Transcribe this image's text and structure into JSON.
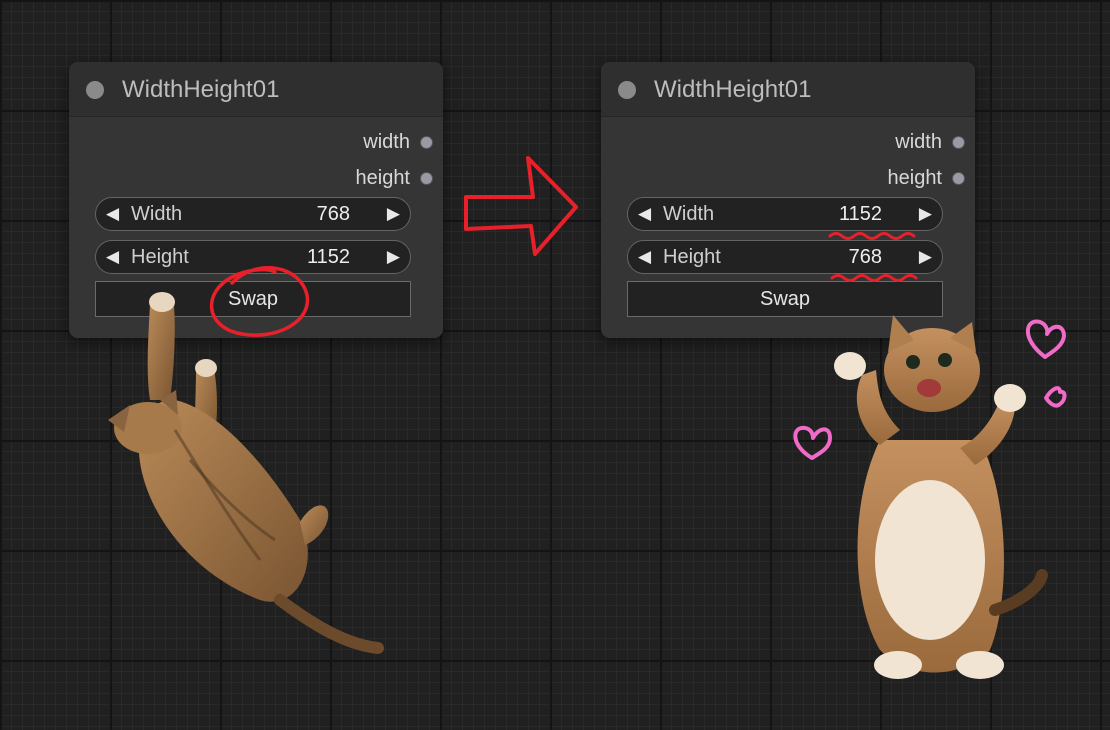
{
  "nodes": [
    {
      "title": "WidthHeight01",
      "outputs": [
        "width",
        "height"
      ],
      "widgets": [
        {
          "label": "Width",
          "value": "768"
        },
        {
          "label": "Height",
          "value": "1152"
        }
      ],
      "button_label": "Swap"
    },
    {
      "title": "WidthHeight01",
      "outputs": [
        "width",
        "height"
      ],
      "widgets": [
        {
          "label": "Width",
          "value": "1152"
        },
        {
          "label": "Height",
          "value": "768"
        }
      ],
      "button_label": "Swap"
    }
  ],
  "glyphs": {
    "decrement": "◀",
    "increment": "▶"
  },
  "colors": {
    "canvas": "#202020",
    "node_body": "#353535",
    "annotation": "#e8202a",
    "heart": "#f06ac8",
    "cat_fur": "#9a6a3c"
  }
}
